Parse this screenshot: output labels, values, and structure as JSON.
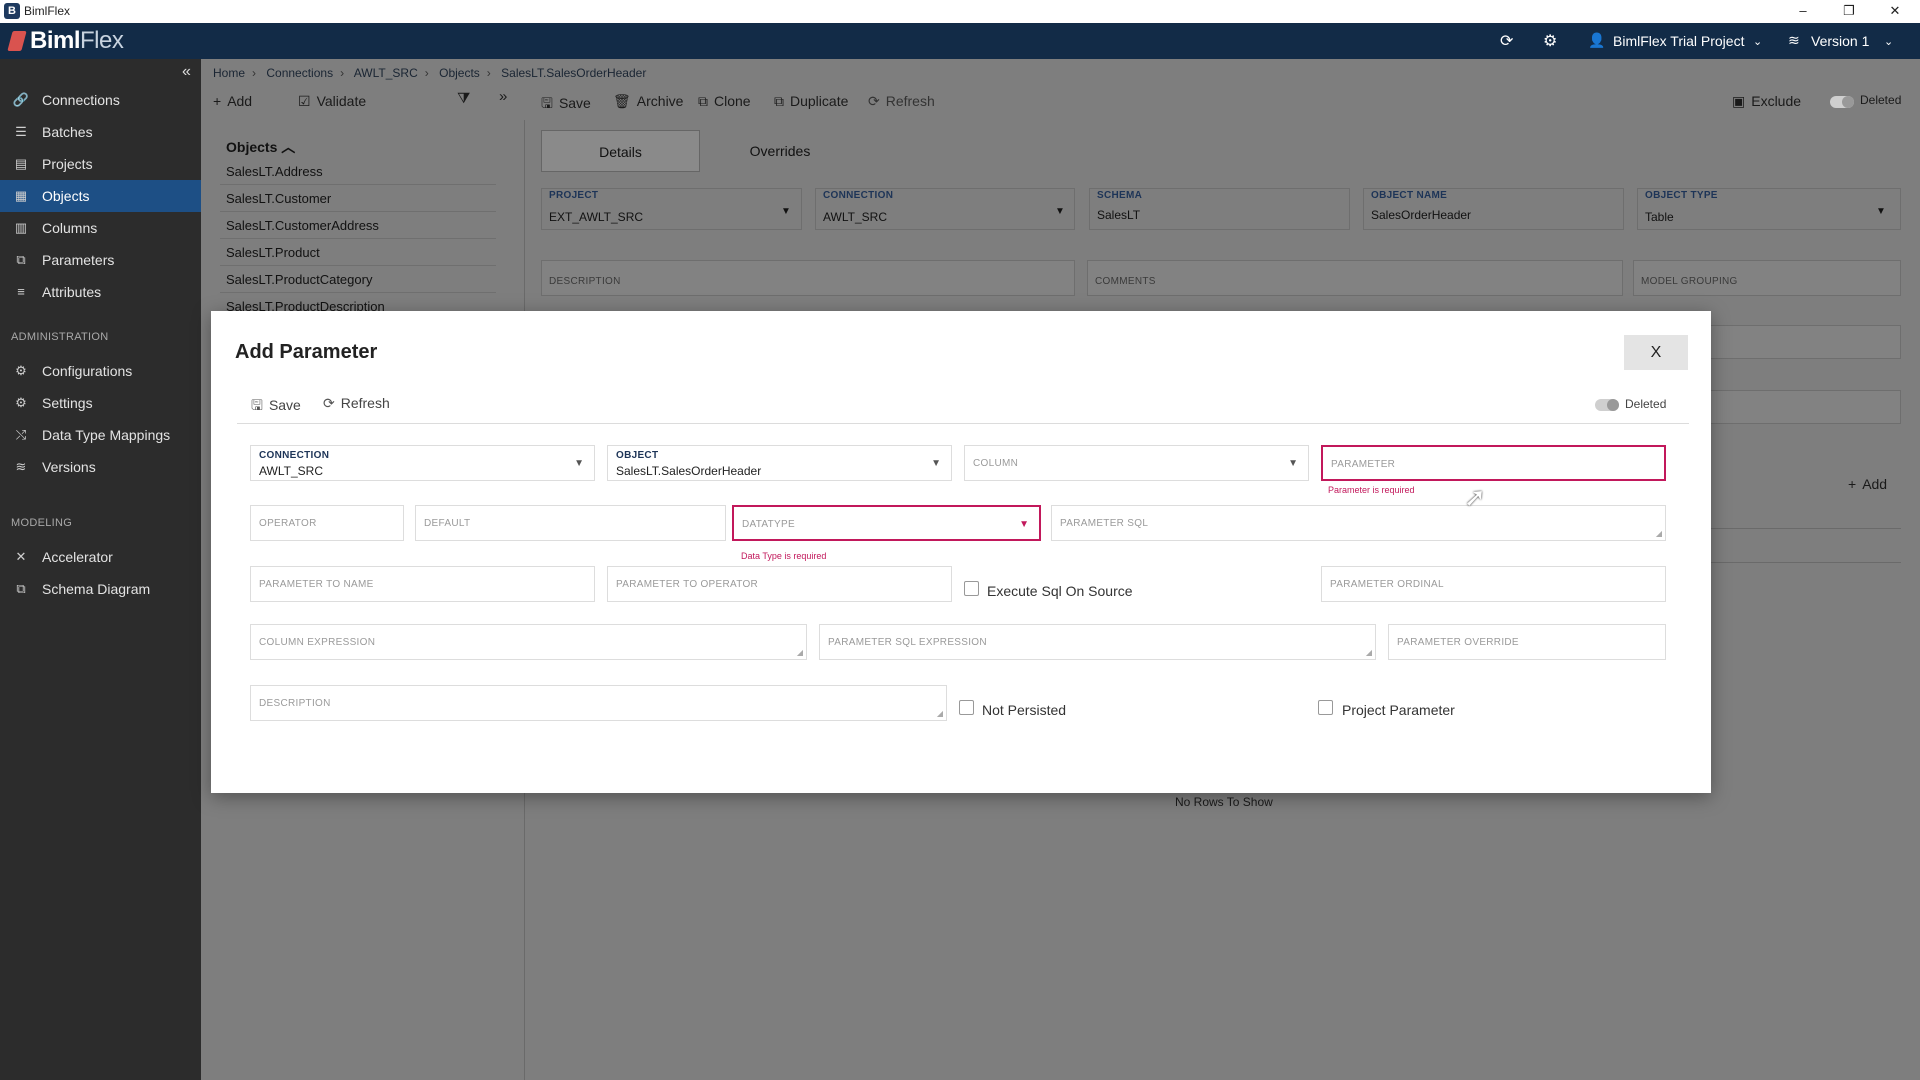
{
  "window": {
    "title": "BimlFlex",
    "minimize": "–",
    "maximize": "❐",
    "close": "✕"
  },
  "header": {
    "logo_biml": "Biml",
    "logo_flex": "Flex",
    "project": "BimlFlex Trial Project",
    "version": "Version 1"
  },
  "sidebar": {
    "items": [
      {
        "label": "Connections",
        "icon": "link-icon"
      },
      {
        "label": "Batches",
        "icon": "stack-icon"
      },
      {
        "label": "Projects",
        "icon": "projects-icon"
      },
      {
        "label": "Objects",
        "icon": "objects-icon",
        "active": true
      },
      {
        "label": "Columns",
        "icon": "columns-icon"
      },
      {
        "label": "Parameters",
        "icon": "parameters-icon"
      },
      {
        "label": "Attributes",
        "icon": "attributes-icon"
      }
    ],
    "section_admin": "ADMINISTRATION",
    "admin_items": [
      {
        "label": "Configurations",
        "icon": "configurations-icon"
      },
      {
        "label": "Settings",
        "icon": "gear-icon"
      },
      {
        "label": "Data Type Mappings",
        "icon": "mapping-icon"
      },
      {
        "label": "Versions",
        "icon": "versions-icon"
      }
    ],
    "section_modeling": "MODELING",
    "modeling_items": [
      {
        "label": "Accelerator",
        "icon": "accelerator-icon"
      },
      {
        "label": "Schema Diagram",
        "icon": "schema-diagram-icon"
      }
    ]
  },
  "breadcrumb": [
    "Home",
    "Connections",
    "AWLT_SRC",
    "Objects",
    "SalesLT.SalesOrderHeader"
  ],
  "left_toolbar": {
    "add": "Add",
    "validate": "Validate"
  },
  "toolbar": {
    "save": "Save",
    "archive": "Archive",
    "clone": "Clone",
    "duplicate": "Duplicate",
    "refresh": "Refresh",
    "exclude": "Exclude",
    "deleted": "Deleted"
  },
  "objects_panel": {
    "header": "Objects",
    "items": [
      "SalesLT.Address",
      "SalesLT.Customer",
      "SalesLT.CustomerAddress",
      "SalesLT.Product",
      "SalesLT.ProductCategory",
      "SalesLT.ProductDescription"
    ]
  },
  "tabs": [
    "Details",
    "Overrides"
  ],
  "detail_form": {
    "project_label": "PROJECT",
    "project_value": "EXT_AWLT_SRC",
    "connection_label": "CONNECTION",
    "connection_value": "AWLT_SRC",
    "schema_label": "SCHEMA",
    "schema_value": "SalesLT",
    "object_name_label": "OBJECT NAME",
    "object_name_value": "SalesOrderHeader",
    "object_type_label": "OBJECT TYPE",
    "object_type_value": "Table",
    "description_ph": "DESCRIPTION",
    "comments_ph": "COMMENTS",
    "model_grouping_ph": "MODEL GROUPING"
  },
  "grid": {
    "add": "Add",
    "empty": "No Rows To Show"
  },
  "modal": {
    "title": "Add Parameter",
    "close": "X",
    "save": "Save",
    "refresh": "Refresh",
    "deleted": "Deleted",
    "connection_label": "CONNECTION",
    "connection_value": "AWLT_SRC",
    "object_label": "OBJECT",
    "object_value": "SalesLT.SalesOrderHeader",
    "column_ph": "COLUMN",
    "parameter_ph": "PARAMETER",
    "parameter_error": "Parameter is required",
    "operator_ph": "OPERATOR",
    "default_ph": "DEFAULT",
    "datatype_ph": "DATATYPE",
    "datatype_error": "Data Type is required",
    "parameter_sql_ph": "PARAMETER SQL",
    "parameter_to_name_ph": "PARAMETER TO NAME",
    "parameter_to_operator_ph": "PARAMETER TO OPERATOR",
    "execute_sql_label": "Execute Sql On Source",
    "parameter_ordinal_ph": "PARAMETER ORDINAL",
    "column_expression_ph": "COLUMN EXPRESSION",
    "parameter_sql_expression_ph": "PARAMETER SQL EXPRESSION",
    "parameter_override_ph": "PARAMETER OVERRIDE",
    "description_ph": "DESCRIPTION",
    "not_persisted_label": "Not Persisted",
    "project_parameter_label": "Project Parameter"
  }
}
